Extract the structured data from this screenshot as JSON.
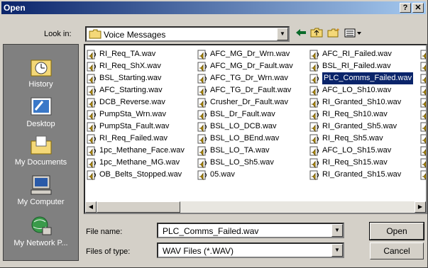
{
  "window": {
    "title": "Open",
    "help_label": "?",
    "close_label": "✕"
  },
  "lookin": {
    "label": "Look in:",
    "value": "Voice Messages"
  },
  "places": [
    {
      "label": "History"
    },
    {
      "label": "Desktop"
    },
    {
      "label": "My Documents"
    },
    {
      "label": "My Computer"
    },
    {
      "label": "My Network P..."
    }
  ],
  "files": {
    "col1": [
      "RI_Req_TA.wav",
      "RI_Req_ShX.wav",
      "BSL_Starting.wav",
      "AFC_Starting.wav",
      "DCB_Reverse.wav",
      "PumpSta_Wrn.wav",
      "PumpSta_Fault.wav",
      "RI_Req_Failed.wav",
      "1pc_Methane_Face.wav",
      "1pc_Methane_MG.wav",
      "OB_Belts_Stopped.wav"
    ],
    "col2": [
      "AFC_MG_Dr_Wrn.wav",
      "AFC_MG_Dr_Fault.wav",
      "AFC_TG_Dr_Wrn.wav",
      "AFC_TG_Dr_Fault.wav",
      "Crusher_Dr_Fault.wav",
      "BSL_Dr_Fault.wav",
      "BSL_LO_DCB.wav",
      "BSL_LO_BEnd.wav",
      "BSL_LO_TA.wav",
      "BSL_LO_Sh5.wav",
      "05.wav"
    ],
    "col3": [
      "AFC_RI_Failed.wav",
      "BSL_RI_Failed.wav",
      "PLC_Comms_Failed.wav",
      "AFC_LO_Sh10.wav",
      "RI_Granted_Sh10.wav",
      "RI_Req_Sh10.wav",
      "RI_Granted_Sh5.wav",
      "RI_Req_Sh5.wav",
      "AFC_LO_Sh15.wav",
      "RI_Req_Sh15.wav",
      "RI_Granted_Sh15.wav"
    ]
  },
  "form": {
    "filename_label": "File name:",
    "filename_value": "PLC_Comms_Failed.wav",
    "filetype_label": "Files of type:",
    "filetype_value": "WAV Files (*.WAV)",
    "open_label": "Open",
    "cancel_label": "Cancel"
  }
}
